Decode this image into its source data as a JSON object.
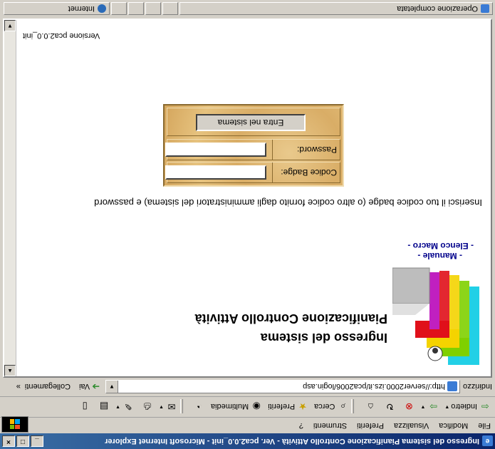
{
  "window": {
    "title": "Ingresso del sistema Pianificazione Controllo Attività - Ver. pca2.0.0_init - Microsoft Internet Explorer",
    "controls": {
      "minimize": "_",
      "maximize": "□",
      "close": "×"
    }
  },
  "menu": {
    "items": [
      "File",
      "Modifica",
      "Visualizza",
      "Preferiti",
      "Strumenti",
      "?"
    ]
  },
  "toolbar": {
    "back": "Indietro",
    "search": "Cerca",
    "favorites": "Preferiti",
    "multimedia": "Multimedia"
  },
  "address": {
    "label": "Indirizzo",
    "url": "http://server2000.izs.it/pca2006/login.asp",
    "go": "Vai",
    "links": "Collegamenti"
  },
  "page": {
    "title_line1": "Ingresso del sistema",
    "title_line2": "Pianificazione Controllo Attività",
    "links": {
      "manuale": "- Manuale -",
      "elenco_macro": "- Elenco Macro -"
    },
    "instruction": "Inserisci il tuo codice badge (o altro codice fornito dagli amministratori del sistema) e password",
    "login": {
      "badge_label": "Codice Badge:",
      "password_label": "Password:",
      "enter_button": "Entra nel sistema"
    },
    "version": "Versione pca2.0.0_init"
  },
  "status": {
    "text": "Operazione completata",
    "zone": "Internet"
  },
  "colors": {
    "title_bar": "#0a246a",
    "link": "#00008b",
    "login_panel": "#d9ad66"
  }
}
